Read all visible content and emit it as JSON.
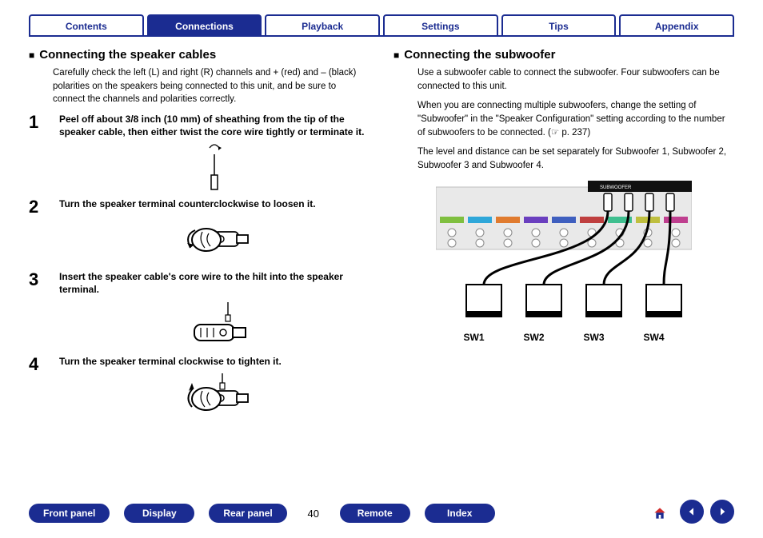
{
  "topTabs": [
    {
      "label": "Contents",
      "active": false
    },
    {
      "label": "Connections",
      "active": true
    },
    {
      "label": "Playback",
      "active": false
    },
    {
      "label": "Settings",
      "active": false
    },
    {
      "label": "Tips",
      "active": false
    },
    {
      "label": "Appendix",
      "active": false
    }
  ],
  "left": {
    "heading": "Connecting the speaker cables",
    "intro": "Carefully check the left (L) and right (R) channels and + (red) and – (black) polarities on the speakers being connected to this unit, and be sure to connect the channels and polarities correctly.",
    "steps": [
      {
        "num": "1",
        "label": "Peel off about 3/8 inch (10 mm) of sheathing from the tip of the speaker cable, then either twist the core wire tightly or terminate it."
      },
      {
        "num": "2",
        "label": "Turn the speaker terminal counterclockwise to loosen it."
      },
      {
        "num": "3",
        "label": "Insert the speaker cable's core wire to the hilt into the speaker terminal."
      },
      {
        "num": "4",
        "label": "Turn the speaker terminal clockwise to tighten it."
      }
    ]
  },
  "right": {
    "heading": "Connecting the subwoofer",
    "paras": [
      "Use a subwoofer cable to connect the subwoofer. Four subwoofers can be connected to this unit.",
      "When you are connecting multiple subwoofers, change the setting of \"Subwoofer\" in the \"Speaker Configuration\" setting according to the number of subwoofers to be connected.  (☞ p. 237)",
      "The level and distance can be set separately for Subwoofer 1, Subwoofer 2, Subwoofer 3 and Subwoofer 4."
    ],
    "swLabels": [
      "SW1",
      "SW2",
      "SW3",
      "SW4"
    ]
  },
  "bottomNav": {
    "pills": [
      "Front panel",
      "Display",
      "Rear panel"
    ],
    "pageNumber": "40",
    "pillsRight": [
      "Remote",
      "Index"
    ]
  }
}
